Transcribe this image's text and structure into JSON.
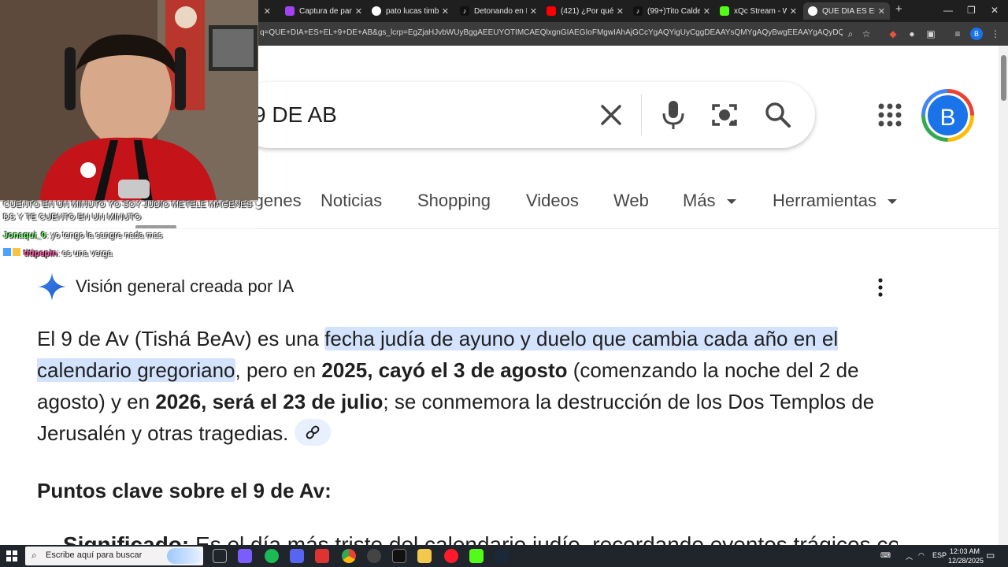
{
  "browser": {
    "tabs": [
      {
        "label": "",
        "color": "#3c3c3c"
      },
      {
        "label": "Captura de pantalla",
        "color": "#a142f4"
      },
      {
        "label": "pato lucas timbre",
        "color": "#ffffff"
      },
      {
        "label": "Detonando en Ba",
        "color": "#111111"
      },
      {
        "label": "(421) ¿Por qué los",
        "color": "#ff0000"
      },
      {
        "label": "(99+)Tito Calderó",
        "color": "#111111"
      },
      {
        "label": "xQc Stream - Wa",
        "color": "#53fc18"
      },
      {
        "label": "QUE DIA ES EL 9 D",
        "color": "#ffffff"
      }
    ],
    "new_tab_label": "+",
    "url": "q=QUE+DIA+ES+EL+9+DE+AB&gs_lcrp=EgZjaHJvbWUyBggAEEUYOTIMCAEQlxgnGIAEGIoFMgwIAhAjGCcYgAQYigUyCggDEAAYsQMYgAQyBwgEEAAYgAQyDQgFEAAYgwEYsQM...",
    "profile_initial": "B"
  },
  "search": {
    "query_visible": "9 DE AB",
    "profile_initial": "B"
  },
  "search_tabs": [
    {
      "label": "Imágenes"
    },
    {
      "label": "Noticias"
    },
    {
      "label": "Shopping"
    },
    {
      "label": "Videos"
    },
    {
      "label": "Web"
    },
    {
      "label": "Más"
    },
    {
      "label": "Herramientas"
    }
  ],
  "ai_overview": {
    "title": "Visión general creada por IA",
    "p1": "El 9 de Av (Tishá BeAv) es una ",
    "p1_highlight": "fecha judía de ayuno y duelo que cambia cada año en el calendario gregoriano",
    "p2": ", pero en ",
    "b1": "2025, cayó el 3 de agosto",
    "p3": " (comenzando la noche del 2 de agosto) y en ",
    "b2": "2026, será el 23 de julio",
    "p4": "; se conmemora la destrucción de los Dos Templos de Jerusalén y otras tragedias.",
    "key_points_heading": "Puntos clave sobre el 9 de Av:",
    "cut_bold": "Significado:",
    "cut_text": " Es el día más triste del calendario judío, recordando eventos trágicos como"
  },
  "stream_chat": {
    "line1": "CUENTO EN UN MINUTO YO SOY JUDIO METELE MAGENES",
    "line2": "DS Y TE CUENTO EN UN MINUTO",
    "messages": [
      {
        "user": "Jonaqui_0",
        "text": ": yo tengo la sangre nada mas",
        "color": "#7dff7d"
      },
      {
        "user": "titipepin",
        "text": ": es una verga",
        "color": "#ff5fa8"
      }
    ]
  },
  "taskbar": {
    "search_placeholder": "Escribe aquí para buscar",
    "language": "ESP",
    "time": "12:03 AM",
    "date": "12/28/2025"
  }
}
